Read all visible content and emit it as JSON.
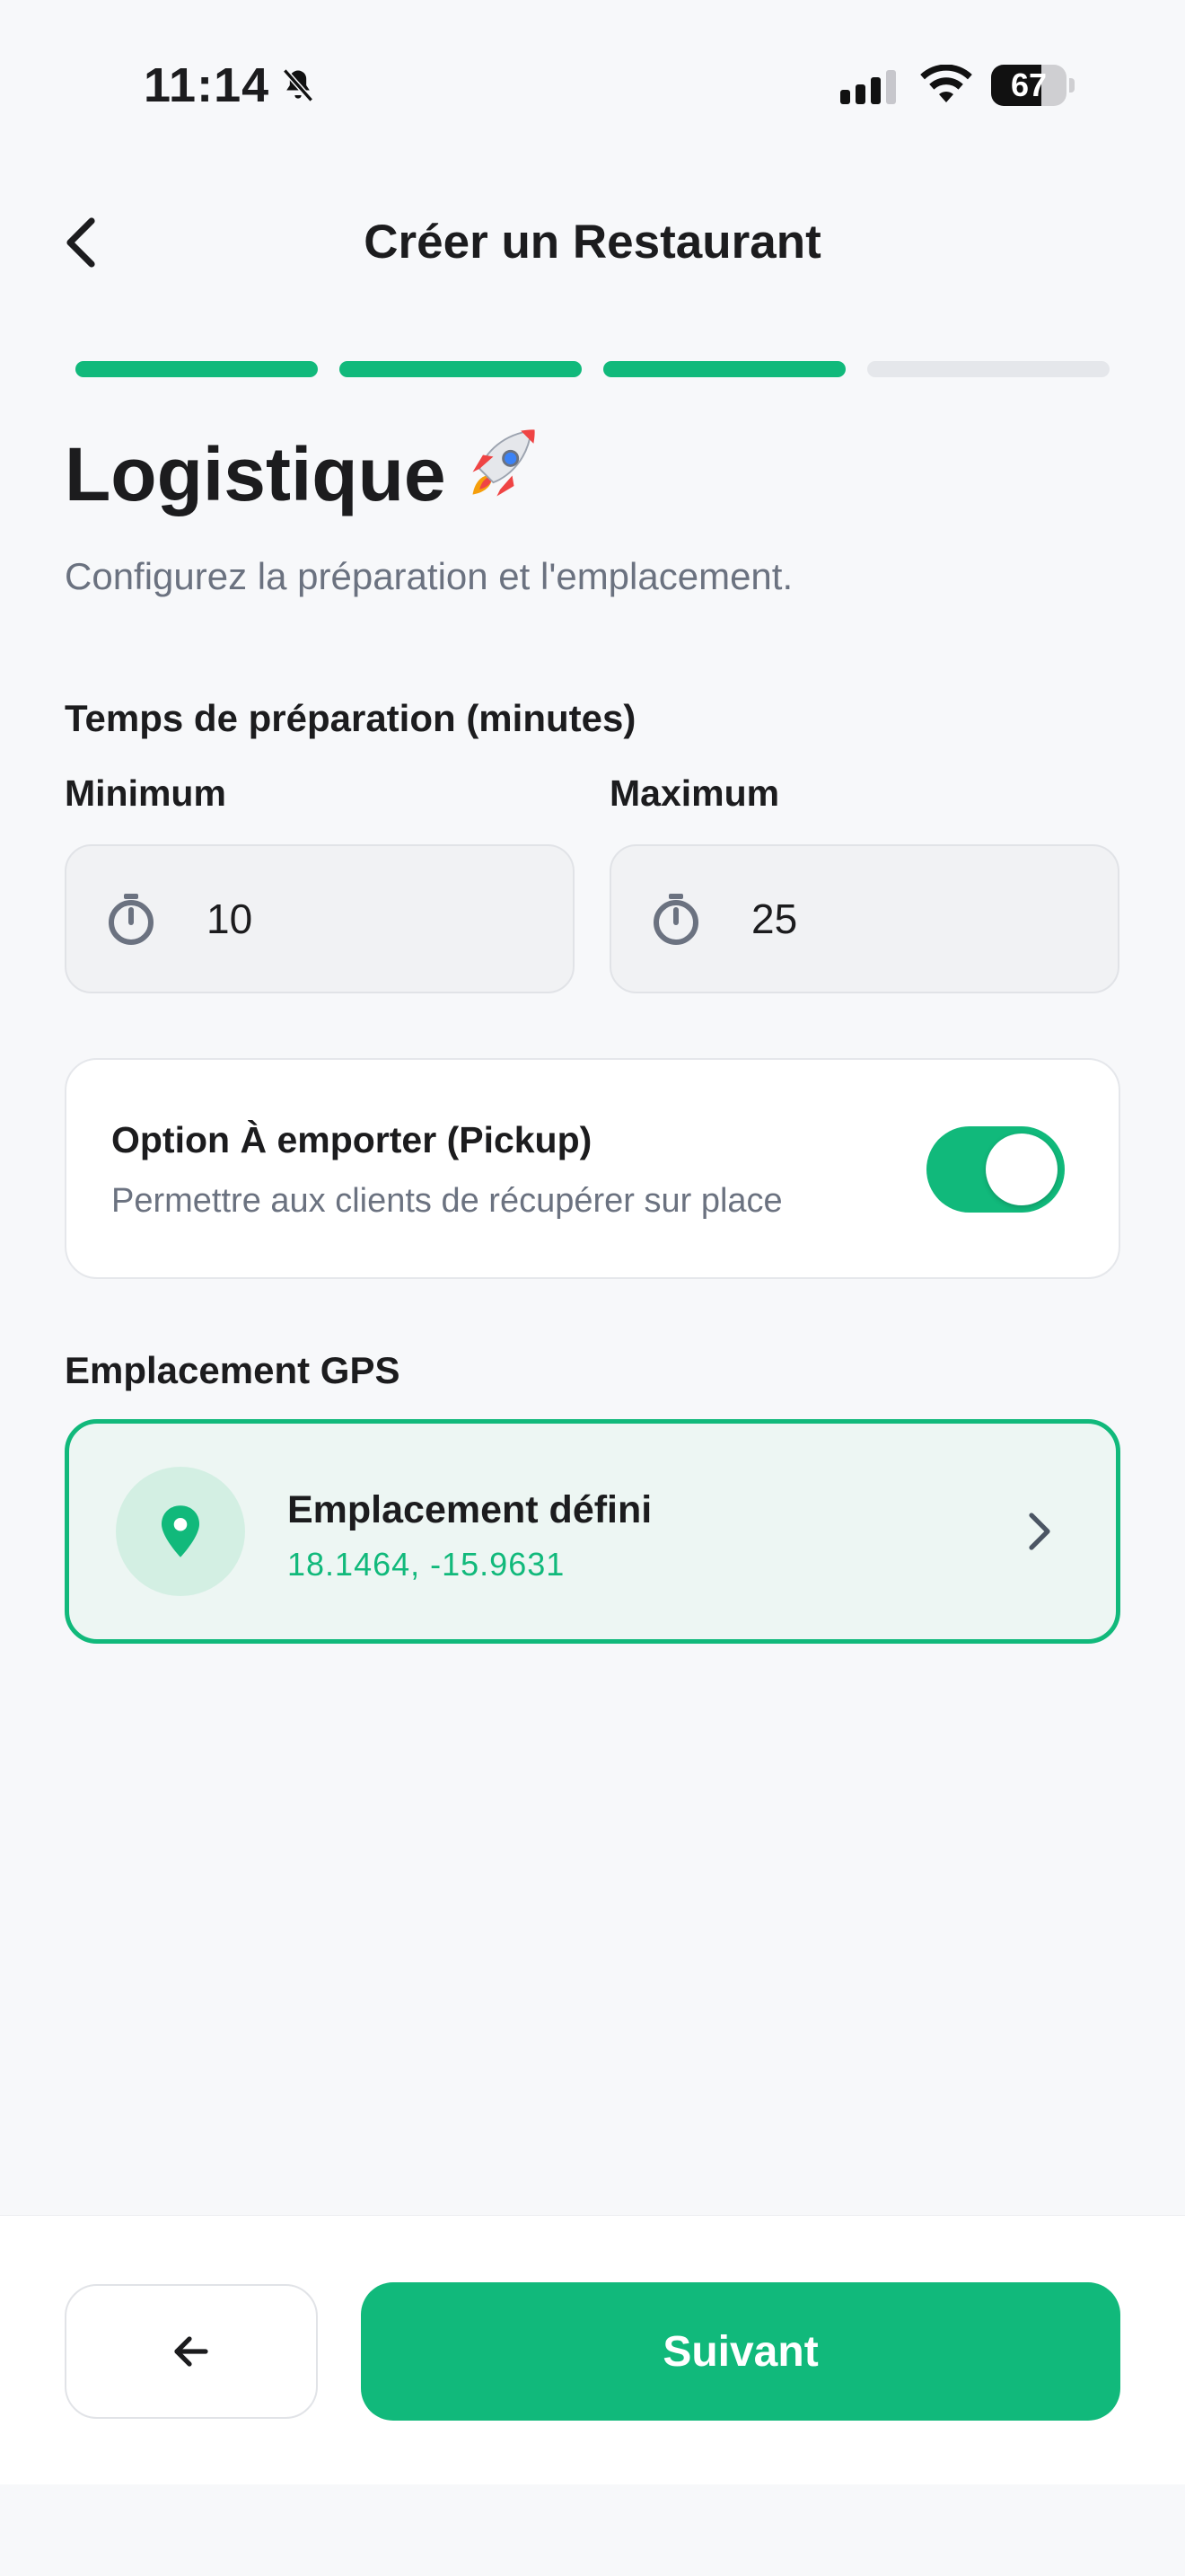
{
  "status_bar": {
    "time": "11:14",
    "battery": "67"
  },
  "header": {
    "title": "Créer un Restaurant"
  },
  "progress": {
    "total_steps": 4,
    "completed_steps": 3
  },
  "content": {
    "heading": "Logistique",
    "heading_emoji": "🚀",
    "subtitle": "Configurez la préparation et l'emplacement."
  },
  "prep_time": {
    "label": "Temps de préparation (minutes)",
    "min_label": "Minimum",
    "min_value": "10",
    "max_label": "Maximum",
    "max_value": "25"
  },
  "pickup": {
    "title": "Option À emporter (Pickup)",
    "description": "Permettre aux clients de récupérer sur place",
    "enabled": true
  },
  "gps": {
    "label": "Emplacement GPS",
    "title": "Emplacement défini",
    "coords": "18.1464, -15.9631"
  },
  "footer": {
    "next_label": "Suivant"
  },
  "colors": {
    "accent": "#11b97b",
    "background": "#f7f8fa",
    "muted_text": "#6b7280"
  }
}
